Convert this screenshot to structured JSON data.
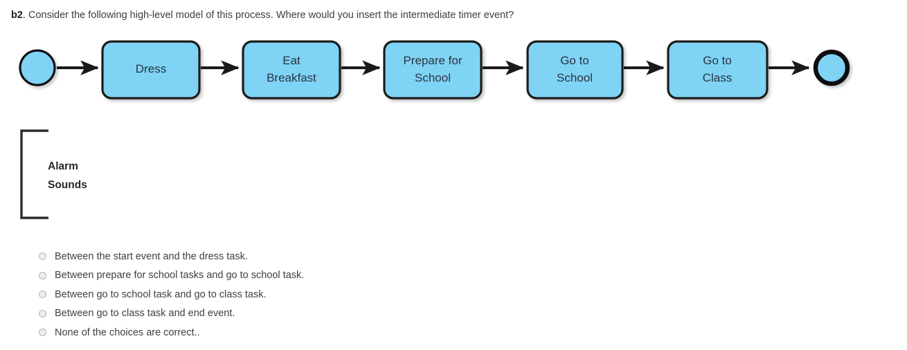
{
  "question": {
    "label": "b2",
    "text": ". Consider the following high-level model of this process. Where would you insert the intermediate timer event?"
  },
  "diagram": {
    "type": "bpmn-process",
    "colors": {
      "task_fill": "#7FD3F5",
      "task_stroke": "#1a1a1a",
      "event_fill": "#7FD3F5",
      "event_stroke": "#111111",
      "connector": "#1a1a1a",
      "label_text": "#2a3440",
      "annotation_text": "#24292e"
    },
    "start_event": {
      "name": "start-event"
    },
    "end_event": {
      "name": "end-event"
    },
    "tasks": [
      {
        "lines": [
          "Dress"
        ]
      },
      {
        "lines": [
          "Eat",
          "Breakfast"
        ]
      },
      {
        "lines": [
          "Prepare for",
          "School"
        ]
      },
      {
        "lines": [
          "Go to",
          "School"
        ]
      },
      {
        "lines": [
          "Go to",
          "Class"
        ]
      }
    ],
    "annotation": {
      "lines": [
        "Alarm",
        "Sounds"
      ]
    }
  },
  "answers": {
    "choices": [
      {
        "text": "Between the start event and the dress task.",
        "selected": false
      },
      {
        "text": "Between prepare for school tasks and go to school task.",
        "selected": false
      },
      {
        "text": "Between go to school task and go to class task.",
        "selected": false
      },
      {
        "text": "Between go to class task and end event.",
        "selected": false
      },
      {
        "text": "None of the choices are correct..",
        "selected": false
      }
    ]
  }
}
